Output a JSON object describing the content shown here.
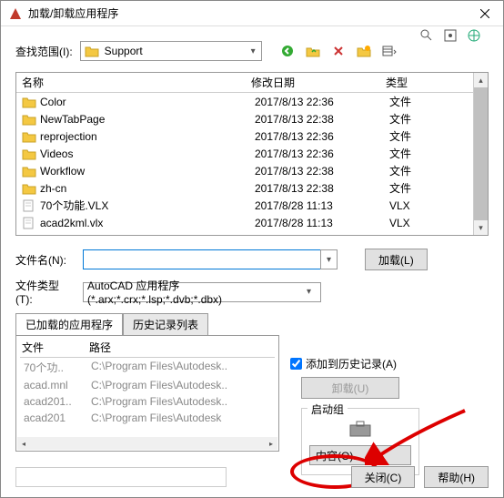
{
  "titlebar": {
    "title": "加载/卸载应用程序"
  },
  "search": {
    "label": "查找范围(I):",
    "path": "Support"
  },
  "filelist": {
    "headers": {
      "name": "名称",
      "date": "修改日期",
      "type": "类型"
    },
    "rows": [
      {
        "name": "Color",
        "date": "2017/8/13 22:36",
        "type": "文件",
        "kind": "folder"
      },
      {
        "name": "NewTabPage",
        "date": "2017/8/13 22:38",
        "type": "文件",
        "kind": "folder"
      },
      {
        "name": "reprojection",
        "date": "2017/8/13 22:36",
        "type": "文件",
        "kind": "folder"
      },
      {
        "name": "Videos",
        "date": "2017/8/13 22:36",
        "type": "文件",
        "kind": "folder"
      },
      {
        "name": "Workflow",
        "date": "2017/8/13 22:38",
        "type": "文件",
        "kind": "folder"
      },
      {
        "name": "zh-cn",
        "date": "2017/8/13 22:38",
        "type": "文件",
        "kind": "folder"
      },
      {
        "name": "70个功能.VLX",
        "date": "2017/8/28 11:13",
        "type": "VLX",
        "kind": "file"
      },
      {
        "name": "acad2kml.vlx",
        "date": "2017/8/28 11:13",
        "type": "VLX",
        "kind": "file"
      }
    ]
  },
  "form": {
    "filename_label": "文件名(N):",
    "filename_value": "",
    "filetype_label": "文件类型(T):",
    "filetype_value": "AutoCAD 应用程序(*.arx;*.crx;*.lsp;*.dvb;*.dbx)",
    "load_btn": "加载(L)"
  },
  "tabs": {
    "loaded": "已加载的应用程序",
    "history": "历史记录列表"
  },
  "loaded": {
    "col1": "文件",
    "col2": "路径",
    "rows": [
      {
        "file": "70个功..",
        "path": "C:\\Program Files\\Autodesk.."
      },
      {
        "file": "acad.mnl",
        "path": "C:\\Program Files\\Autodesk.."
      },
      {
        "file": "acad201..",
        "path": "C:\\Program Files\\Autodesk.."
      },
      {
        "file": "acad201",
        "path": "C:\\Program Files\\Autodesk"
      }
    ]
  },
  "right": {
    "add_history": "添加到历史记录(A)",
    "unload_btn": "卸载(U)",
    "startup_title": "启动组",
    "content_btn": "内容(O)..."
  },
  "bottom": {
    "close_btn": "关闭(C)",
    "help_btn": "帮助(H)"
  }
}
